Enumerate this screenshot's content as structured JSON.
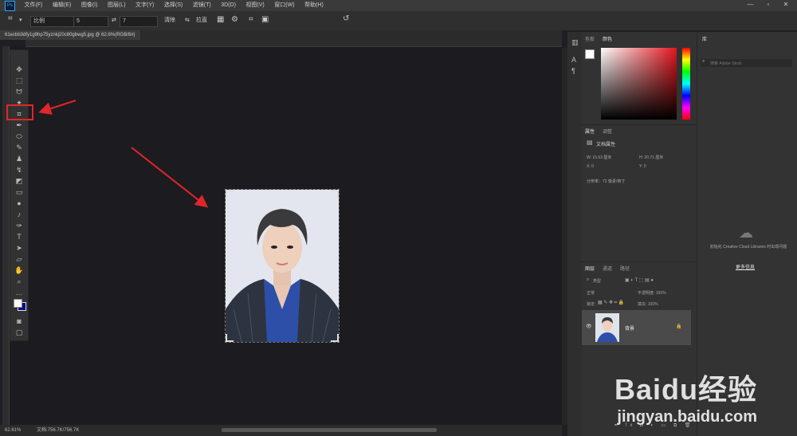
{
  "app": {
    "logo": "Ps"
  },
  "menu": [
    "文件(F)",
    "编辑(E)",
    "图像(I)",
    "图层(L)",
    "文字(Y)",
    "选择(S)",
    "滤镜(T)",
    "3D(D)",
    "视图(V)",
    "窗口(W)",
    "帮助(H)"
  ],
  "window_controls": [
    "—",
    "▫",
    "✕"
  ],
  "options_bar": {
    "ratio_select": "比例",
    "field1": "5",
    "field2": "7",
    "clear_label": "清除",
    "straighten_label": "拉直",
    "swap": "⇄"
  },
  "document": {
    "tab_title": "61ecbb3dfy1g9hp75yznkj20c80gbwg5.jpg @ 62.6%(RGB/8#)"
  },
  "status": {
    "zoom": "62.61%",
    "doc_size": "文档:756.7K/756.7K"
  },
  "panels": {
    "color_tabs": [
      "色板",
      "颜色"
    ],
    "props_tabs": [
      "属性",
      "调整"
    ],
    "props_title": "文档属性",
    "props_w": "W: 15.53 厘米",
    "props_h": "H: 20.71 厘米",
    "props_x": "X: 0",
    "props_y": "Y: 0",
    "props_res": "分辨率：72 像素/英寸",
    "layers_tabs": [
      "图层",
      "通道",
      "路径"
    ],
    "layers_kind": "类型",
    "layers_mode": "正常",
    "layers_opacity": "不透明度: 100%",
    "layers_lock": "锁定:",
    "layers_fill": "填充: 100%",
    "layer_name": "背景"
  },
  "library": {
    "tab": "库",
    "search_placeholder": "搜索 Adobe Stock",
    "message": "初始化 Creative Cloud Libraries 时出现问题",
    "more_info": "更多信息"
  },
  "watermark": {
    "brand": "Baidu经验",
    "url": "jingyan.baidu.com"
  },
  "colors": {
    "accent": "#31a8ff",
    "annotation": "#e0262a",
    "canvas": "#1c1b20"
  }
}
